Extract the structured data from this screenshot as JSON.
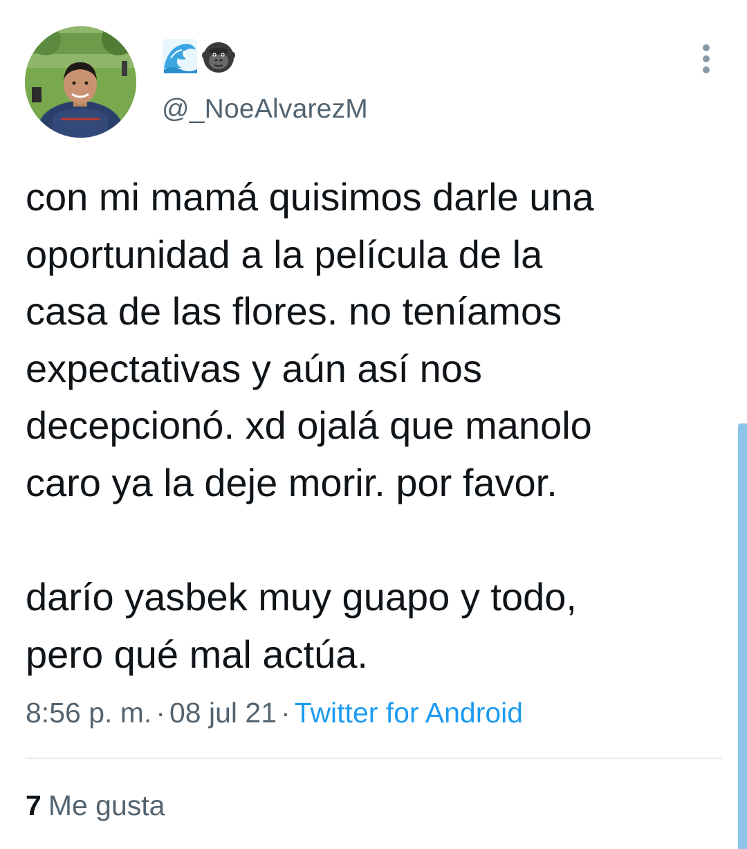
{
  "user": {
    "avatar_icon": "profile-photo",
    "display_name_icons": [
      "water-wave-icon",
      "gorilla-icon"
    ],
    "handle": "@_NoeAlvarezM"
  },
  "menu": {
    "icon": "more-vertical-icon"
  },
  "tweet": {
    "lines": [
      "con mi mamá quisimos darle una",
      "oportunidad a la película de la",
      "casa de las flores. no teníamos",
      "expectativas y aún así nos",
      "decepcionó. xd ojalá que manolo",
      "caro ya la deje morir. por favor.",
      "",
      "darío yasbek muy guapo y todo,",
      "pero qué mal actúa."
    ]
  },
  "meta": {
    "time": "8:56 p. m.",
    "separator": "·",
    "date": "08 jul 21",
    "source": "Twitter for Android"
  },
  "likes": {
    "count": "7",
    "label": "Me gusta"
  },
  "colors": {
    "text": "#0f1419",
    "secondary": "#536471",
    "link": "#1d9bf0",
    "divider": "#e6ecf0",
    "scrollbar": "#8ec4ea"
  }
}
